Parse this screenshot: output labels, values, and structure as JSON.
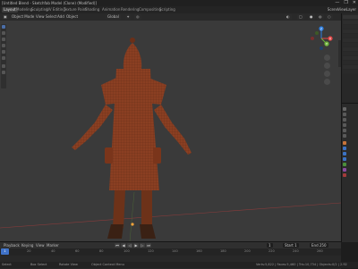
{
  "window": {
    "title": "[Untitled Blend - Sketchfab Model (Clone) (Modified)]",
    "controls": [
      "—",
      "❐",
      "✕"
    ]
  },
  "menubar": {
    "tabs": [
      "Layout",
      "Modeling",
      "Sculpting",
      "UV Editing",
      "Texture Paint",
      "Shading",
      "Animation",
      "Rendering",
      "Compositing",
      "Scripting"
    ],
    "active_tab": "Layout",
    "scene_label": "Scene",
    "view_layer_label": "ViewLayer"
  },
  "viewport": {
    "mode": "Object Mode",
    "view_menu": "View",
    "select_menu": "Select",
    "add_menu": "Add",
    "object_menu": "Object",
    "transform": "Global",
    "background_color": "#3a3a3a",
    "model_color": "#8a3f22"
  },
  "gizmo": {
    "x_label": "X",
    "y_label": "Y",
    "z_label": "Z"
  },
  "timeline": {
    "playback": "Playback",
    "keying": "Keying",
    "view": "View",
    "marker": "Marker",
    "current_frame": "1",
    "start_label": "Start",
    "start": "1",
    "end_label": "End",
    "end": "250",
    "ticks": [
      "0",
      "20",
      "40",
      "60",
      "80",
      "100",
      "120",
      "140",
      "160",
      "180",
      "200",
      "220",
      "240",
      "260"
    ]
  },
  "statusbar": {
    "select": "Select",
    "box_select": "Box Select",
    "rotate_view": "Rotate View",
    "context_menu": "Object Context Menu",
    "stats": "Verts:5,822 | Faces:5,460 | Tris:10,734 | Objects:0/2 | 2.92"
  }
}
